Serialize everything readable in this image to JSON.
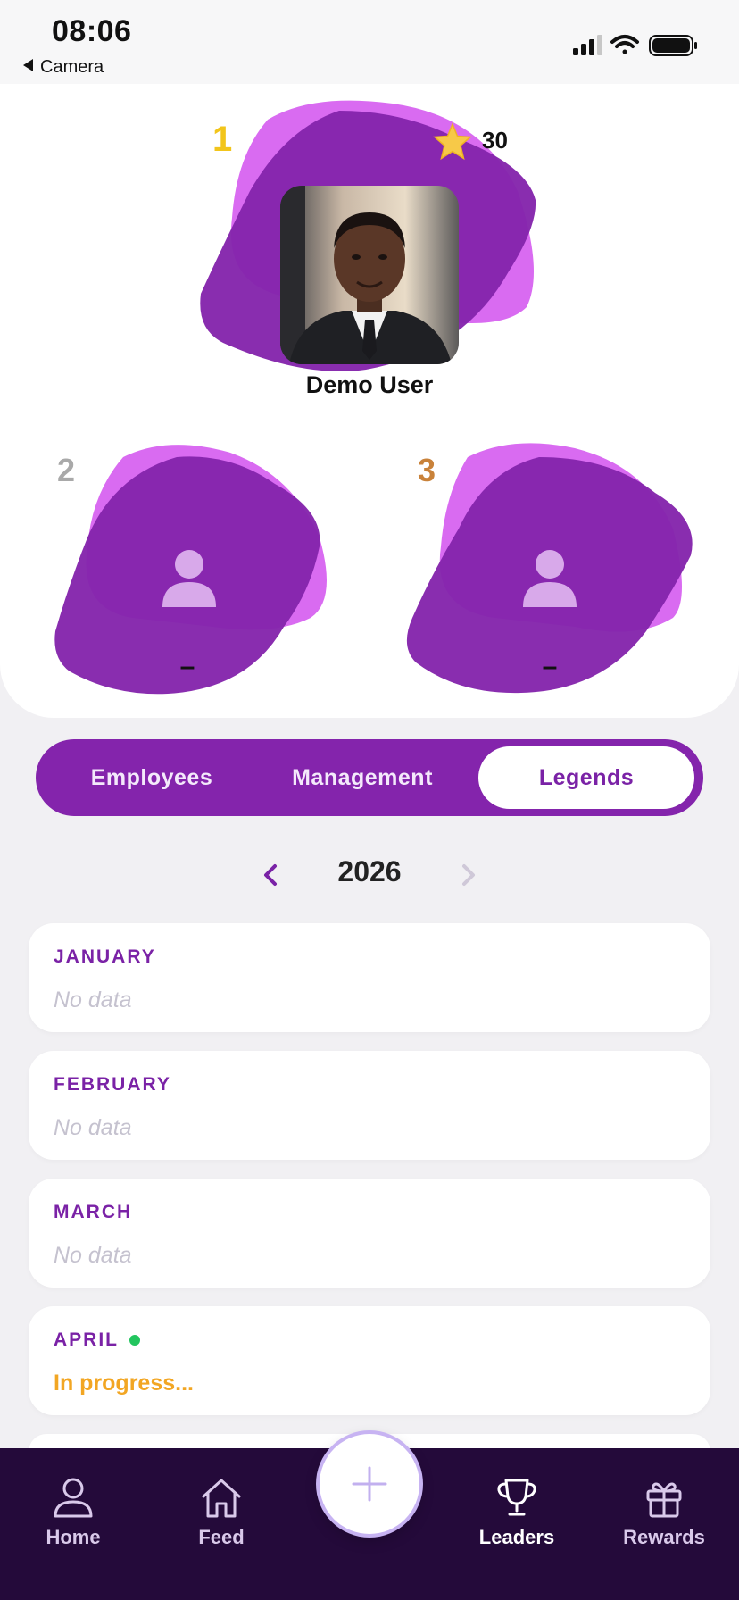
{
  "status_bar": {
    "time": "08:06",
    "back_label": "Camera"
  },
  "podium": {
    "first": {
      "rank": "1",
      "name": "Demo User",
      "points": "30"
    },
    "second": {
      "rank": "2",
      "name": "–"
    },
    "third": {
      "rank": "3",
      "name": "–"
    }
  },
  "tabs": [
    {
      "label": "Employees",
      "active": false
    },
    {
      "label": "Management",
      "active": false
    },
    {
      "label": "Legends",
      "active": true
    }
  ],
  "year_nav": {
    "year": "2026"
  },
  "months": [
    {
      "name": "JANUARY",
      "status": "No data"
    },
    {
      "name": "FEBRUARY",
      "status": "No data"
    },
    {
      "name": "MARCH",
      "status": "No data"
    },
    {
      "name": "APRIL",
      "status": "In progress..."
    }
  ],
  "bottom_nav": {
    "home": "Home",
    "feed": "Feed",
    "leaders": "Leaders",
    "rewards": "Rewards"
  },
  "colors": {
    "primary": "#8424ac",
    "blob_light": "#d96bf1",
    "gold": "#f2c51b",
    "silver": "#a9a9a9",
    "bronze": "#c9823a",
    "in_progress": "#f2a623",
    "nav_bg": "#240a3a"
  }
}
